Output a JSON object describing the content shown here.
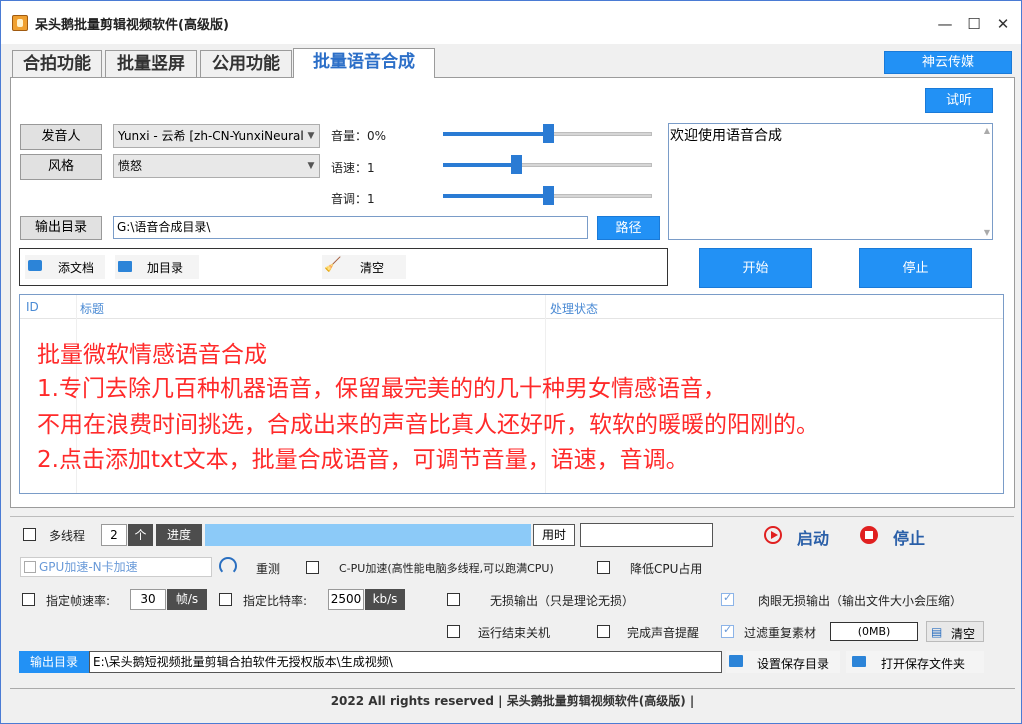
{
  "window": {
    "title": "呆头鹅批量剪辑视频软件(高级版)",
    "min_icon": "minimize-icon",
    "max_icon": "maximize-icon",
    "close_icon": "close-icon"
  },
  "tabs": [
    {
      "label": "合拍功能",
      "active": false
    },
    {
      "label": "批量竖屏",
      "active": false
    },
    {
      "label": "公用功能",
      "active": false
    },
    {
      "label": "批量语音合成",
      "active": true
    }
  ],
  "top_right_button": "神云传媒",
  "tts": {
    "preview_button": "试听",
    "speaker_button": "发音人",
    "speaker_value": "Yunxi - 云希  [zh-CN-YunxiNeural]",
    "style_button": "风格",
    "style_value": "愤怒",
    "volume_label": "音量：0%",
    "volume_level": 0.5,
    "rate_label": "语速：1",
    "rate_level": 0.35,
    "pitch_label": "音调：1",
    "pitch_level": 0.5,
    "output_button": "输出目录",
    "output_value": "G:\\语音合成目录\\",
    "path_button": "路径",
    "text_area": "欢迎使用语音合成",
    "add_doc_button": "添文档",
    "add_dir_button": "加目录",
    "clear_button": "清空",
    "start_button": "开始",
    "stop_button": "停止"
  },
  "table": {
    "columns": [
      "ID",
      "标题",
      "处理状态"
    ]
  },
  "red_text": [
    "批量微软情感语音合成",
    "1.专门去除几百种机器语音，保留最完美的的几十种男女情感语音，",
    "不用在浪费时间挑选，合成出来的声音比真人还好听，软软的暖暖的阳刚的。",
    "2.点击添加txt文本，批量合成语音，可调节音量，语速，音调。"
  ],
  "bottom": {
    "multithread_label": "多线程",
    "thread_count": "2",
    "unit_label": "个",
    "progress_button": "进度",
    "progress": 0.0,
    "time_button": "用时",
    "time_value": "",
    "launch_button": "启动",
    "halt_button": "停止",
    "gpu_label": "GPU加速-N卡加速",
    "retest_label": "重测",
    "cpu_label": "C-PU加速(高性能电脑多线程,可以跑满CPU)",
    "lower_cpu_label": "降低CPU占用",
    "fps_label": "指定帧速率:",
    "fps_value": "30",
    "fps_unit": "帧/s",
    "bitrate_label": "指定比特率:",
    "bitrate_value": "2500",
    "bitrate_unit": "kb/s",
    "lossless_label": "无损输出（只是理论无损）",
    "visual_lossless_label": "肉眼无损输出（输出文件大小会压缩）",
    "shutdown_label": "运行结束关机",
    "sound_label": "完成声音提醒",
    "filter_label": "过滤重复素材",
    "size_value": "(0MB)",
    "clear_label": "清空",
    "output_dir_button": "输出目录",
    "output_dir_value": "E:\\呆头鹅短视频批量剪辑合拍软件无授权版本\\生成视频\\",
    "set_save_dir": "设置保存目录",
    "open_save_dir": "打开保存文件夹"
  },
  "status_bar": "2022 All rights reserved | 呆头鹅批量剪辑视频软件(高级版) |",
  "colors": {
    "accent_blue": "#2291f5",
    "red_text": "#ff2a2a",
    "play_red": "#e02020"
  }
}
